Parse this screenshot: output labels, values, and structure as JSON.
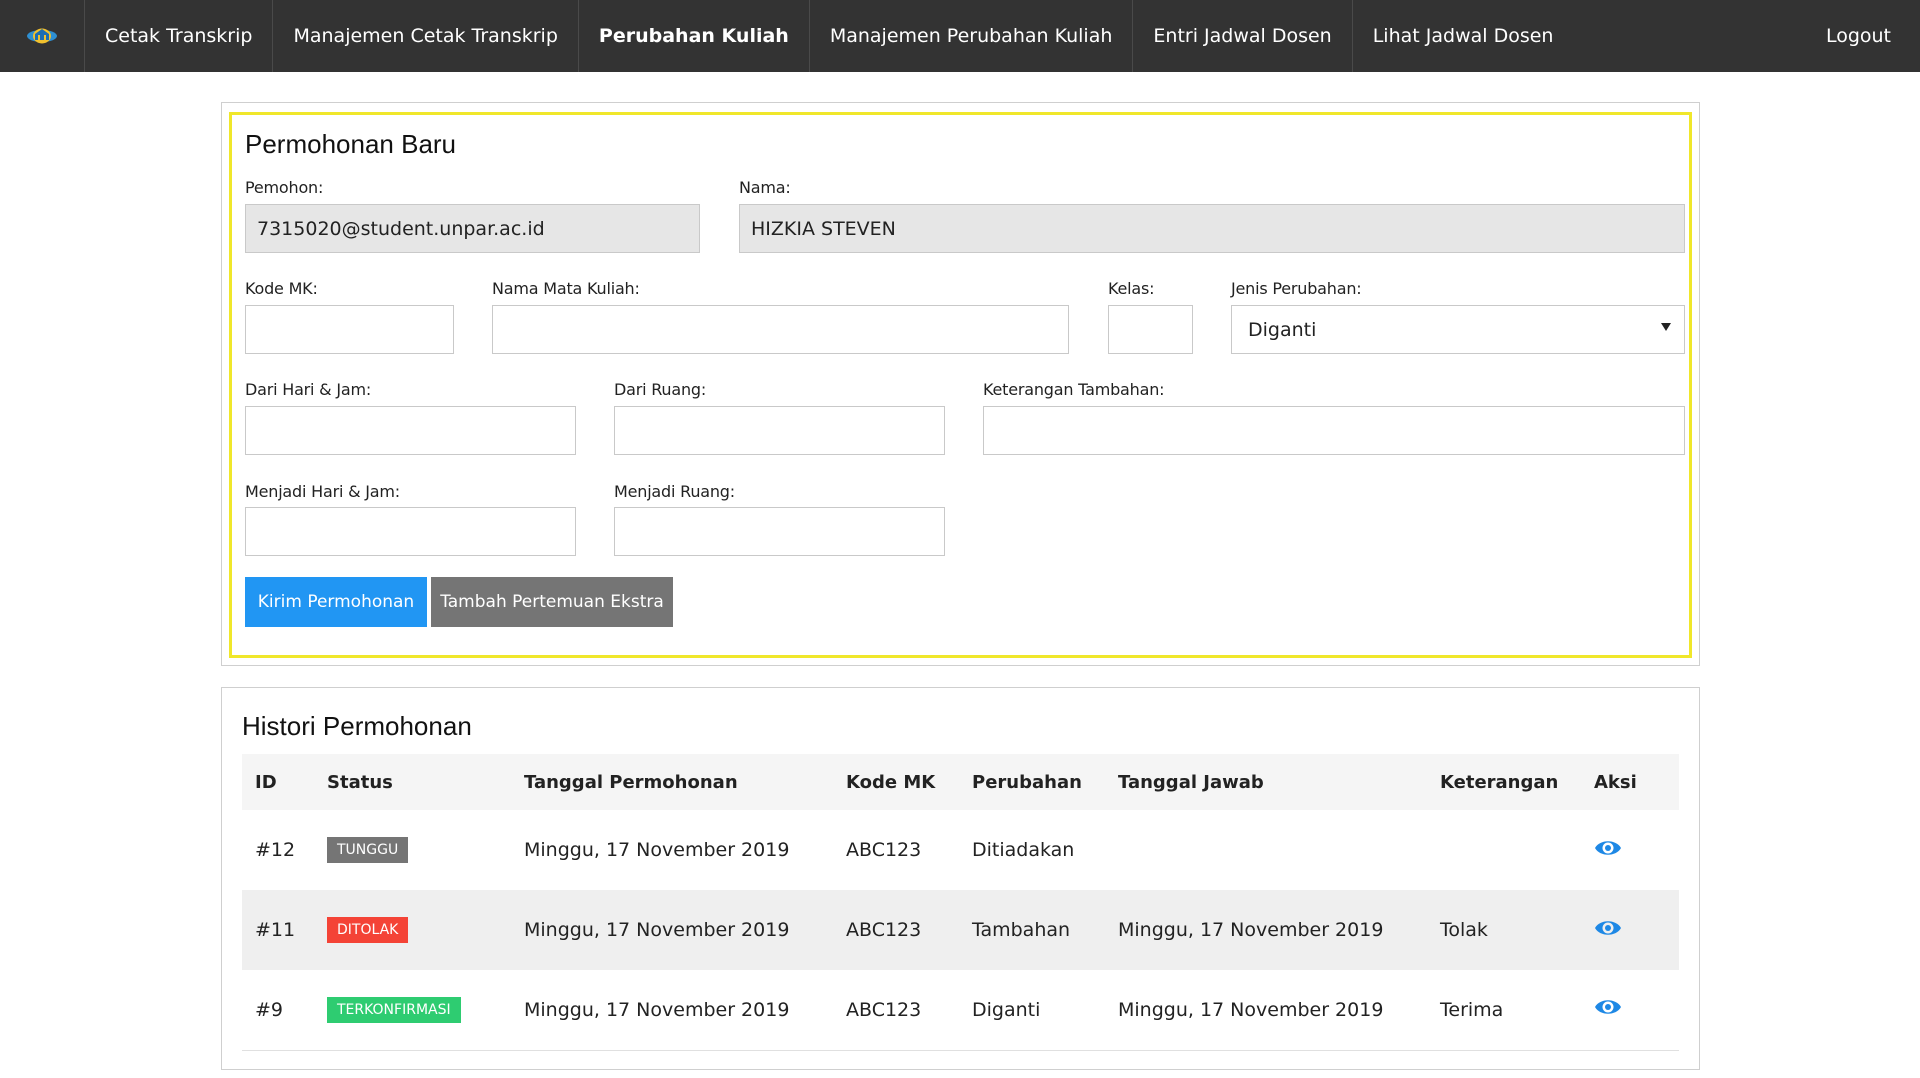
{
  "nav": {
    "items": [
      {
        "label": "Cetak Transkrip"
      },
      {
        "label": "Manajemen Cetak Transkrip"
      },
      {
        "label": "Perubahan Kuliah"
      },
      {
        "label": "Manajemen Perubahan Kuliah"
      },
      {
        "label": "Entri Jadwal Dosen"
      },
      {
        "label": "Lihat Jadwal Dosen"
      }
    ],
    "active_index": 2,
    "logout_label": "Logout",
    "logo_icon": "university-logo-icon"
  },
  "form": {
    "title": "Permohonan Baru",
    "pemohon_label": "Pemohon:",
    "pemohon_value": "7315020@student.unpar.ac.id",
    "nama_label": "Nama:",
    "nama_value": "HIZKIA STEVEN",
    "kode_mk_label": "Kode MK:",
    "kode_mk_value": "",
    "nama_mk_label": "Nama Mata Kuliah:",
    "nama_mk_value": "",
    "kelas_label": "Kelas:",
    "kelas_value": "",
    "jenis_label": "Jenis Perubahan:",
    "jenis_value": "Diganti",
    "dari_hari_label": "Dari Hari & Jam:",
    "dari_ruang_label": "Dari Ruang:",
    "keterangan_label": "Keterangan Tambahan:",
    "menjadi_hari_label": "Menjadi Hari & Jam:",
    "menjadi_ruang_label": "Menjadi Ruang:",
    "submit_label": "Kirim Permohonan",
    "extra_label": "Tambah Pertemuan Ekstra",
    "highlight_color": "#f0e72a"
  },
  "history": {
    "title": "Histori Permohonan",
    "columns": [
      "ID",
      "Status",
      "Tanggal Permohonan",
      "Kode MK",
      "Perubahan",
      "Tanggal Jawab",
      "Keterangan",
      "Aksi"
    ],
    "rows": [
      {
        "id": "#12",
        "status": "TUNGGU",
        "status_color": "#757575",
        "tanggal_permohonan": "Minggu, 17 November 2019",
        "kode_mk": "ABC123",
        "perubahan": "Ditiadakan",
        "tanggal_jawab": "",
        "keterangan": "",
        "aksi_icon": "eye-icon"
      },
      {
        "id": "#11",
        "status": "DITOLAK",
        "status_color": "#f44336",
        "tanggal_permohonan": "Minggu, 17 November 2019",
        "kode_mk": "ABC123",
        "perubahan": "Tambahan",
        "tanggal_jawab": "Minggu, 17 November 2019",
        "keterangan": "Tolak",
        "aksi_icon": "eye-icon"
      },
      {
        "id": "#9",
        "status": "TERKONFIRMASI",
        "status_color": "#2ecc71",
        "tanggal_permohonan": "Minggu, 17 November 2019",
        "kode_mk": "ABC123",
        "perubahan": "Diganti",
        "tanggal_jawab": "Minggu, 17 November 2019",
        "keterangan": "Terima",
        "aksi_icon": "eye-icon"
      }
    ]
  },
  "colors": {
    "navbar": "#333333",
    "primary": "#2196f3",
    "secondary": "#757575",
    "eye_icon": "#1e88e5"
  }
}
